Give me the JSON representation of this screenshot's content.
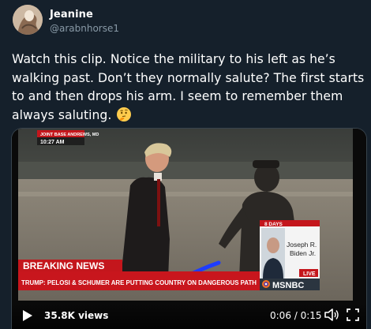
{
  "tweet": {
    "author_name": "Jeanine",
    "author_handle": "@arabnhorse1",
    "text": "Watch this clip. Notice the military to his left as he’s walking past. Don’t they normally salute? The first starts to and then drops his arm. I seem to remember them always saluting.",
    "emoji": "thinking-face"
  },
  "video": {
    "overlay_location": "JOINT BASE ANDREWS, MD",
    "overlay_time": "10:27 AM",
    "breaking_label": "BREAKING NEWS",
    "headline": "TRUMP: PELOSI & SCHUMER ARE PUTTING COUNTRY ON DANGEROUS PATH",
    "countdown": "8 DAYS",
    "inset_name_1": "Joseph R.",
    "inset_name_2": "Biden Jr.",
    "live_label": "LIVE",
    "network": "MSNBC",
    "views": "35.8K views",
    "time": "0:06 / 0:15"
  },
  "colors": {
    "background": "#15202b",
    "secondary_text": "#8899a6",
    "breaking_red": "#c4161c",
    "annotation_blue": "#1e3cff"
  }
}
